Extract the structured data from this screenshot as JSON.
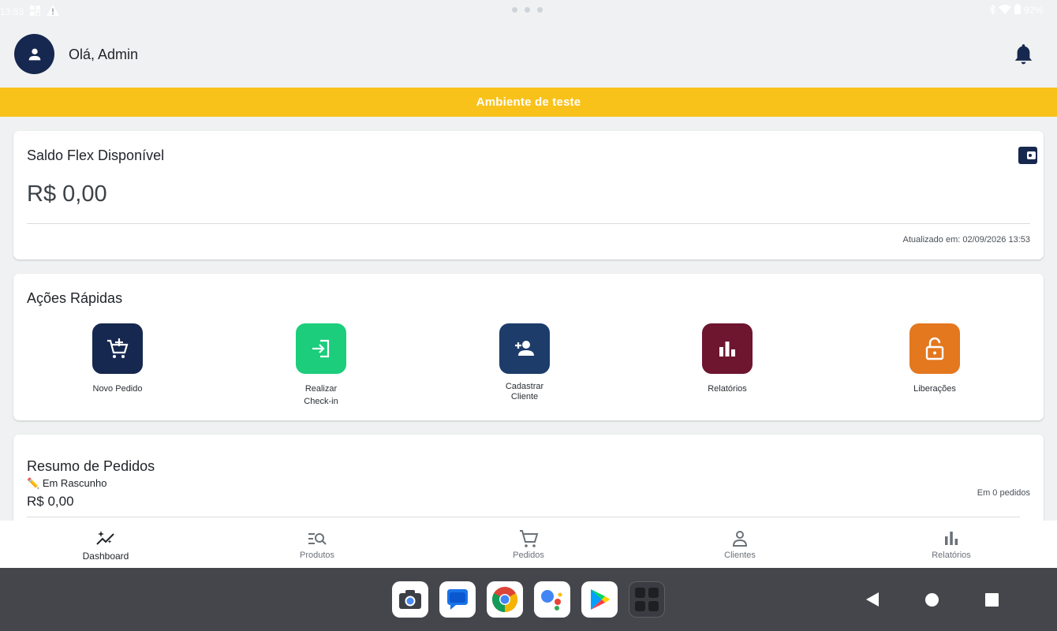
{
  "status_bar": {
    "time": "13:53",
    "battery": "92%"
  },
  "header": {
    "greeting": "Olá, Admin"
  },
  "banner": {
    "text": "Ambiente de teste"
  },
  "balance_card": {
    "title": "Saldo Flex Disponível",
    "amount": "R$ 0,00",
    "updated": "Atualizado em: 02/09/2026 13:53"
  },
  "quick_actions": {
    "title": "Ações Rápidas",
    "items": [
      {
        "label": "Novo Pedido",
        "color": "#16284f",
        "icon": "cart-add-icon"
      },
      {
        "label_line1": "Realizar",
        "label_line2": "Check-in",
        "color": "#1ccd7b",
        "icon": "check-in-icon"
      },
      {
        "label_line1": "Cadastrar",
        "label_line2": "Cliente",
        "color": "#1d3c6a",
        "icon": "person-add-icon"
      },
      {
        "label": "Relatórios",
        "color": "#6e1530",
        "icon": "bar-chart-icon"
      },
      {
        "label": "Liberações",
        "color": "#e3781f",
        "icon": "unlock-icon"
      }
    ]
  },
  "orders_summary": {
    "title": "Resumo de Pedidos",
    "status_emoji": "✏️",
    "status_label": "Em Rascunho",
    "value": "R$ 0,00",
    "count": "Em 0 pedidos"
  },
  "bottom_nav": {
    "items": [
      {
        "label": "Dashboard",
        "active": true
      },
      {
        "label": "Produtos"
      },
      {
        "label": "Pedidos"
      },
      {
        "label": "Clientes"
      },
      {
        "label": "Relatórios"
      }
    ]
  },
  "colors": {
    "accent": "#16284f",
    "banner": "#f9c21a"
  }
}
